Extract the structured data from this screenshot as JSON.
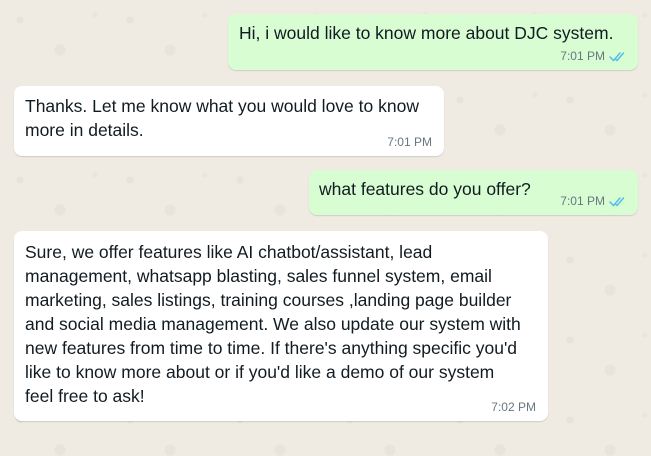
{
  "messages": [
    {
      "direction": "outgoing",
      "text": "Hi, i would like to know more about DJC system.",
      "time": "7:01 PM",
      "status": "double-check-read-icon"
    },
    {
      "direction": "incoming",
      "text": "Thanks. Let me know what you would love to know\nmore in details.",
      "time": "7:01 PM"
    },
    {
      "direction": "outgoing",
      "text": "what features do you offer?",
      "time": "7:01 PM",
      "status": "double-check-read-icon"
    },
    {
      "direction": "incoming",
      "text": "Sure, we offer features like AI chatbot/assistant, lead\nmanagement, whatsapp blasting, sales funnel system, email\nmarketing, sales listings, training courses ,landing page builder\nand social media management. We also update our system with\nnew features from time to time. If there's anything specific you'd\nlike to know more about or if you'd like a demo of our system\nfeel free to ask!",
      "time": "7:02 PM"
    }
  ],
  "colors": {
    "chat_background": "#efeae2",
    "outgoing_bubble": "#d9fdd3",
    "incoming_bubble": "#ffffff",
    "read_ticks": "#53bdeb",
    "timestamp": "#667781"
  }
}
